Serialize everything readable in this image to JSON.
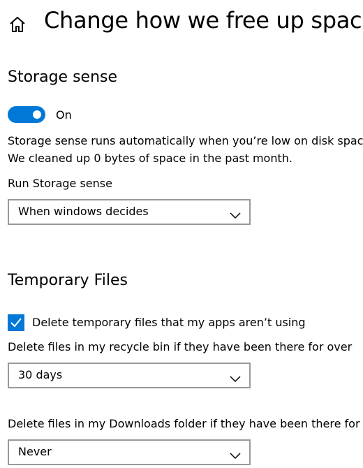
{
  "header": {
    "title": "Change how we free up space",
    "home_icon": "home-icon"
  },
  "storage_sense": {
    "heading": "Storage sense",
    "toggle_state": "On",
    "toggle_on": true,
    "description_line1": "Storage sense runs automatically when you’re low on disk space.",
    "description_line2": "We cleaned up 0 bytes of space in the past month.",
    "run_label": "Run Storage sense",
    "run_value": "When windows decides"
  },
  "temporary_files": {
    "heading": "Temporary Files",
    "delete_temp_label": "Delete temporary files that my apps aren’t using",
    "delete_temp_checked": true,
    "recycle_label": "Delete files in my recycle bin if they have been there for over",
    "recycle_value": "30 days",
    "downloads_label": "Delete files in my Downloads folder if they have been there for over",
    "downloads_value": "Never"
  },
  "colors": {
    "accent": "#0078d7",
    "dropdown_border": "#999999"
  }
}
